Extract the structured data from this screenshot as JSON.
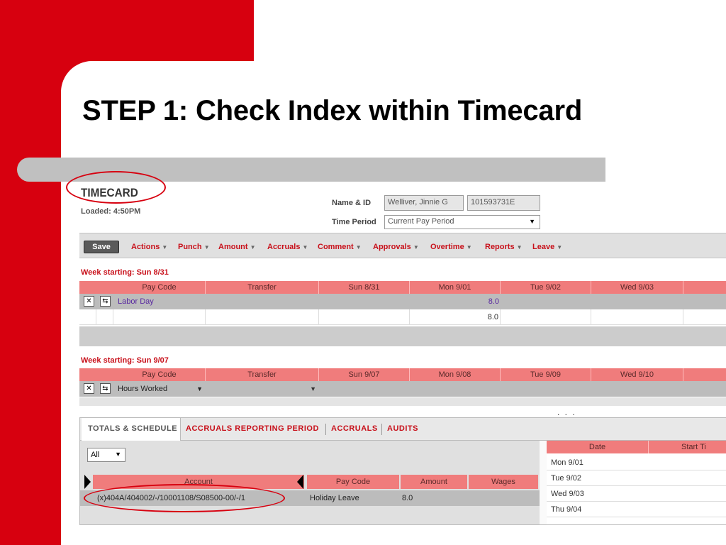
{
  "slide": {
    "title": "STEP 1: Check Index within Timecard"
  },
  "timecard": {
    "title": "TIMECARD",
    "loaded": "Loaded: 4:50PM",
    "name_label": "Name & ID",
    "name_value": "Welliver, Jinnie G",
    "id_value": "101593731E",
    "period_label": "Time Period",
    "period_value": "Current Pay Period",
    "save_label": "Save",
    "menu": [
      "Actions",
      "Punch",
      "Amount",
      "Accruals",
      "Comment",
      "Approvals",
      "Overtime",
      "Reports",
      "Leave"
    ],
    "week1": {
      "label": "Week starting: Sun 8/31",
      "headers": [
        "Pay Code",
        "Transfer",
        "Sun 8/31",
        "Mon 9/01",
        "Tue 9/02",
        "Wed 9/03"
      ],
      "row1_paycode": "Labor Day",
      "row1_mon": "8.0",
      "row2_mon": "8.0"
    },
    "week2": {
      "label": "Week starting: Sun 9/07",
      "headers": [
        "Pay Code",
        "Transfer",
        "Sun 9/07",
        "Mon 9/08",
        "Tue 9/09",
        "Wed 9/10"
      ],
      "row1_paycode": "Hours Worked"
    },
    "ellipsis": ". . .",
    "tabs": [
      "TOTALS & SCHEDULE",
      "ACCRUALS REPORTING PERIOD",
      "ACCRUALS",
      "AUDITS"
    ],
    "filter_value": "All",
    "totals_headers": [
      "Account",
      "Pay Code",
      "Amount",
      "Wages"
    ],
    "totals_row": {
      "account": "(x)404A/404002/-/10001108/S08500-00/-/1",
      "pay_code": "Holiday Leave",
      "amount": "8.0"
    },
    "date_headers": [
      "Date",
      "Start Ti"
    ],
    "dates": [
      "Mon 9/01",
      "Tue 9/02",
      "Wed 9/03",
      "Thu 9/04"
    ]
  },
  "colors": {
    "slide_red": "#d7000f",
    "menu_red": "#c8101a",
    "header_salmon": "#f07c7c",
    "highlight_oval": "#d7000f"
  },
  "icons": [
    "delete-x-icon",
    "transfer-icon",
    "dropdown-arrow-icon",
    "scroll-left-icon"
  ]
}
